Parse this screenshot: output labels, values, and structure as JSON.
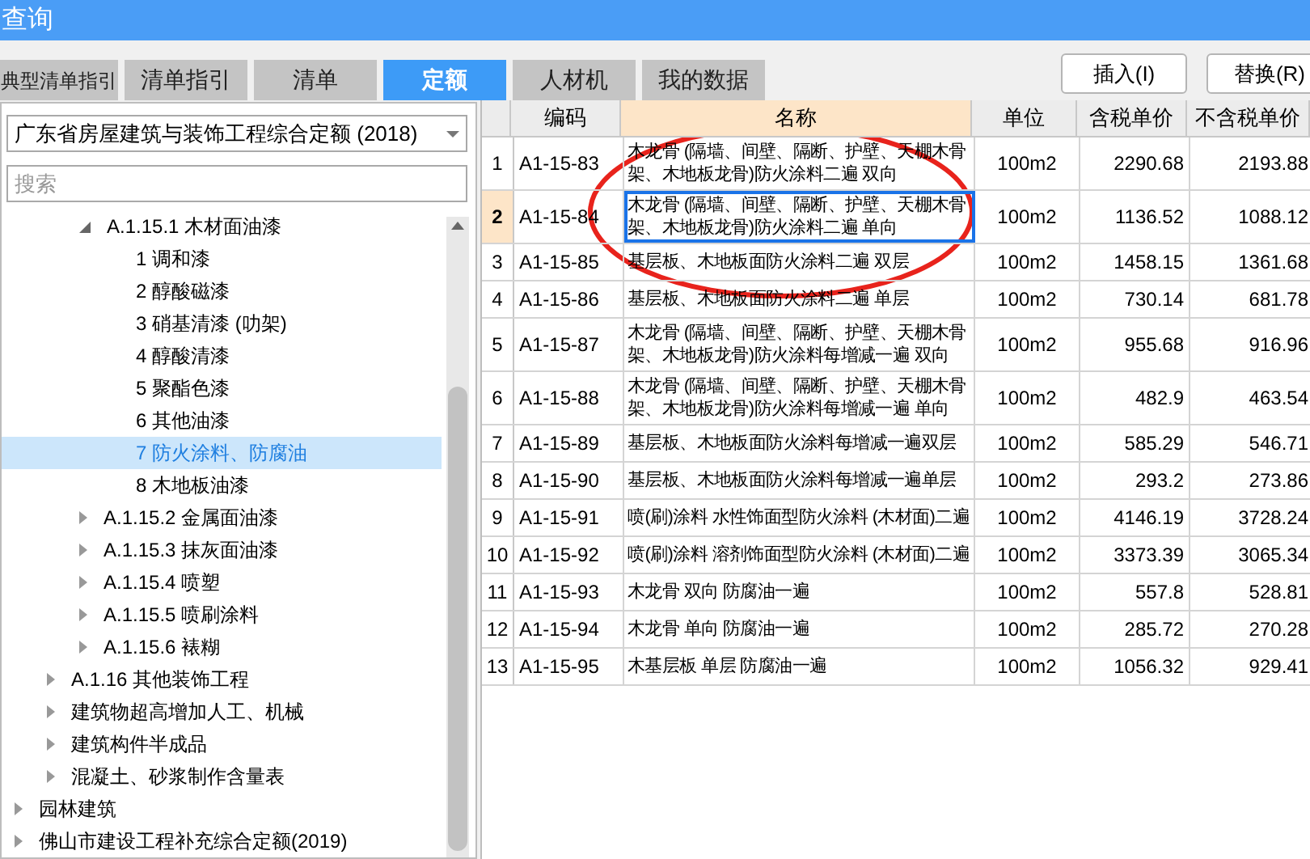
{
  "window": {
    "title": "查询"
  },
  "tabs": [
    {
      "label": "典型清单指引",
      "selected": false
    },
    {
      "label": "清单指引",
      "selected": false
    },
    {
      "label": "清单",
      "selected": false
    },
    {
      "label": "定额",
      "selected": true
    },
    {
      "label": "人材机",
      "selected": false
    },
    {
      "label": "我的数据",
      "selected": false
    }
  ],
  "buttons": [
    "插入(I)",
    "替换(R)"
  ],
  "library_select": {
    "value": "广东省房屋建筑与装饰工程综合定额 (2018)"
  },
  "search": {
    "placeholder": "搜索"
  },
  "tree": [
    {
      "children": [
        {
          "children": [
            {
              "label": "A.1.15.1 木材面油漆",
              "expanded": true,
              "selected": false,
              "children": [
                {
                  "label": "1 调和漆",
                  "selected": false
                },
                {
                  "label": "2 醇酸磁漆",
                  "selected": false
                },
                {
                  "label": "3 硝基清漆 (叻架)",
                  "selected": false
                },
                {
                  "label": "4 醇酸清漆",
                  "selected": false
                },
                {
                  "label": "5 聚酯色漆",
                  "selected": false
                },
                {
                  "label": "6 其他油漆",
                  "selected": false
                },
                {
                  "label": "7 防火涂料、防腐油",
                  "selected": true
                },
                {
                  "label": "8 木地板油漆",
                  "selected": false
                }
              ]
            },
            {
              "label": "A.1.15.2 金属面油漆",
              "expanded": false,
              "selected": false
            },
            {
              "label": "A.1.15.3 抹灰面油漆",
              "expanded": false,
              "selected": false
            },
            {
              "label": "A.1.15.4 喷塑",
              "expanded": false,
              "selected": false
            },
            {
              "label": "A.1.15.5 喷刷涂料",
              "expanded": false,
              "selected": false
            },
            {
              "label": "A.1.15.6 裱糊",
              "expanded": false,
              "selected": false
            }
          ]
        },
        {
          "label": "A.1.16 其他装饰工程",
          "expanded": false,
          "selected": false
        },
        {
          "label": "建筑物超高增加人工、机械",
          "expanded": false,
          "selected": false
        },
        {
          "label": "建筑构件半成品",
          "expanded": false,
          "selected": false
        },
        {
          "label": "混凝土、砂浆制作含量表",
          "expanded": false,
          "selected": false
        }
      ]
    },
    {
      "label": "园林建筑",
      "expanded": false,
      "selected": false
    },
    {
      "label": "佛山市建设工程补充综合定额(2019)",
      "expanded": false,
      "selected": false
    }
  ],
  "table": {
    "columns": [
      {
        "label": "编码",
        "selected": false
      },
      {
        "label": "名称",
        "selected": true
      },
      {
        "label": "单位",
        "selected": false
      },
      {
        "label": "含税单价",
        "selected": false
      },
      {
        "label": "不含税单价",
        "selected": false
      }
    ],
    "rows": [
      {
        "no": "1",
        "code": "A1-15-83",
        "name": "木龙骨 (隔墙、间壁、隔断、护壁、天棚木骨架、木地板龙骨)防火涂料二遍 双向",
        "unit": "100m2",
        "price_tax": "2290.68",
        "price_notax": "2193.88",
        "selected": false
      },
      {
        "no": "2",
        "code": "A1-15-84",
        "name": "木龙骨 (隔墙、间壁、隔断、护壁、天棚木骨架、木地板龙骨)防火涂料二遍 单向",
        "unit": "100m2",
        "price_tax": "1136.52",
        "price_notax": "1088.12",
        "selected": true
      },
      {
        "no": "3",
        "code": "A1-15-85",
        "name": "基层板、木地板面防火涂料二遍 双层",
        "unit": "100m2",
        "price_tax": "1458.15",
        "price_notax": "1361.68",
        "selected": false
      },
      {
        "no": "4",
        "code": "A1-15-86",
        "name": "基层板、木地板面防火涂料二遍 单层",
        "unit": "100m2",
        "price_tax": "730.14",
        "price_notax": "681.78",
        "selected": false
      },
      {
        "no": "5",
        "code": "A1-15-87",
        "name": "木龙骨 (隔墙、间壁、隔断、护壁、天棚木骨架、木地板龙骨)防火涂料每增减一遍 双向",
        "unit": "100m2",
        "price_tax": "955.68",
        "price_notax": "916.96",
        "selected": false
      },
      {
        "no": "6",
        "code": "A1-15-88",
        "name": "木龙骨 (隔墙、间壁、隔断、护壁、天棚木骨架、木地板龙骨)防火涂料每增减一遍 单向",
        "unit": "100m2",
        "price_tax": "482.9",
        "price_notax": "463.54",
        "selected": false
      },
      {
        "no": "7",
        "code": "A1-15-89",
        "name": "基层板、木地板面防火涂料每增减一遍双层",
        "unit": "100m2",
        "price_tax": "585.29",
        "price_notax": "546.71",
        "selected": false
      },
      {
        "no": "8",
        "code": "A1-15-90",
        "name": "基层板、木地板面防火涂料每增减一遍单层",
        "unit": "100m2",
        "price_tax": "293.2",
        "price_notax": "273.86",
        "selected": false
      },
      {
        "no": "9",
        "code": "A1-15-91",
        "name": "喷(刷)涂料 水性饰面型防火涂料 (木材面)二遍",
        "unit": "100m2",
        "price_tax": "4146.19",
        "price_notax": "3728.24",
        "selected": false
      },
      {
        "no": "10",
        "code": "A1-15-92",
        "name": "喷(刷)涂料 溶剂饰面型防火涂料 (木材面)二遍",
        "unit": "100m2",
        "price_tax": "3373.39",
        "price_notax": "3065.34",
        "selected": false
      },
      {
        "no": "11",
        "code": "A1-15-93",
        "name": "木龙骨 双向 防腐油一遍",
        "unit": "100m2",
        "price_tax": "557.8",
        "price_notax": "528.81",
        "selected": false
      },
      {
        "no": "12",
        "code": "A1-15-94",
        "name": "木龙骨 单向 防腐油一遍",
        "unit": "100m2",
        "price_tax": "285.72",
        "price_notax": "270.28",
        "selected": false
      },
      {
        "no": "13",
        "code": "A1-15-95",
        "name": "木基层板 单层 防腐油一遍",
        "unit": "100m2",
        "price_tax": "1056.32",
        "price_notax": "929.41",
        "selected": false
      }
    ]
  },
  "annotation": {
    "kind": "ellipse"
  }
}
